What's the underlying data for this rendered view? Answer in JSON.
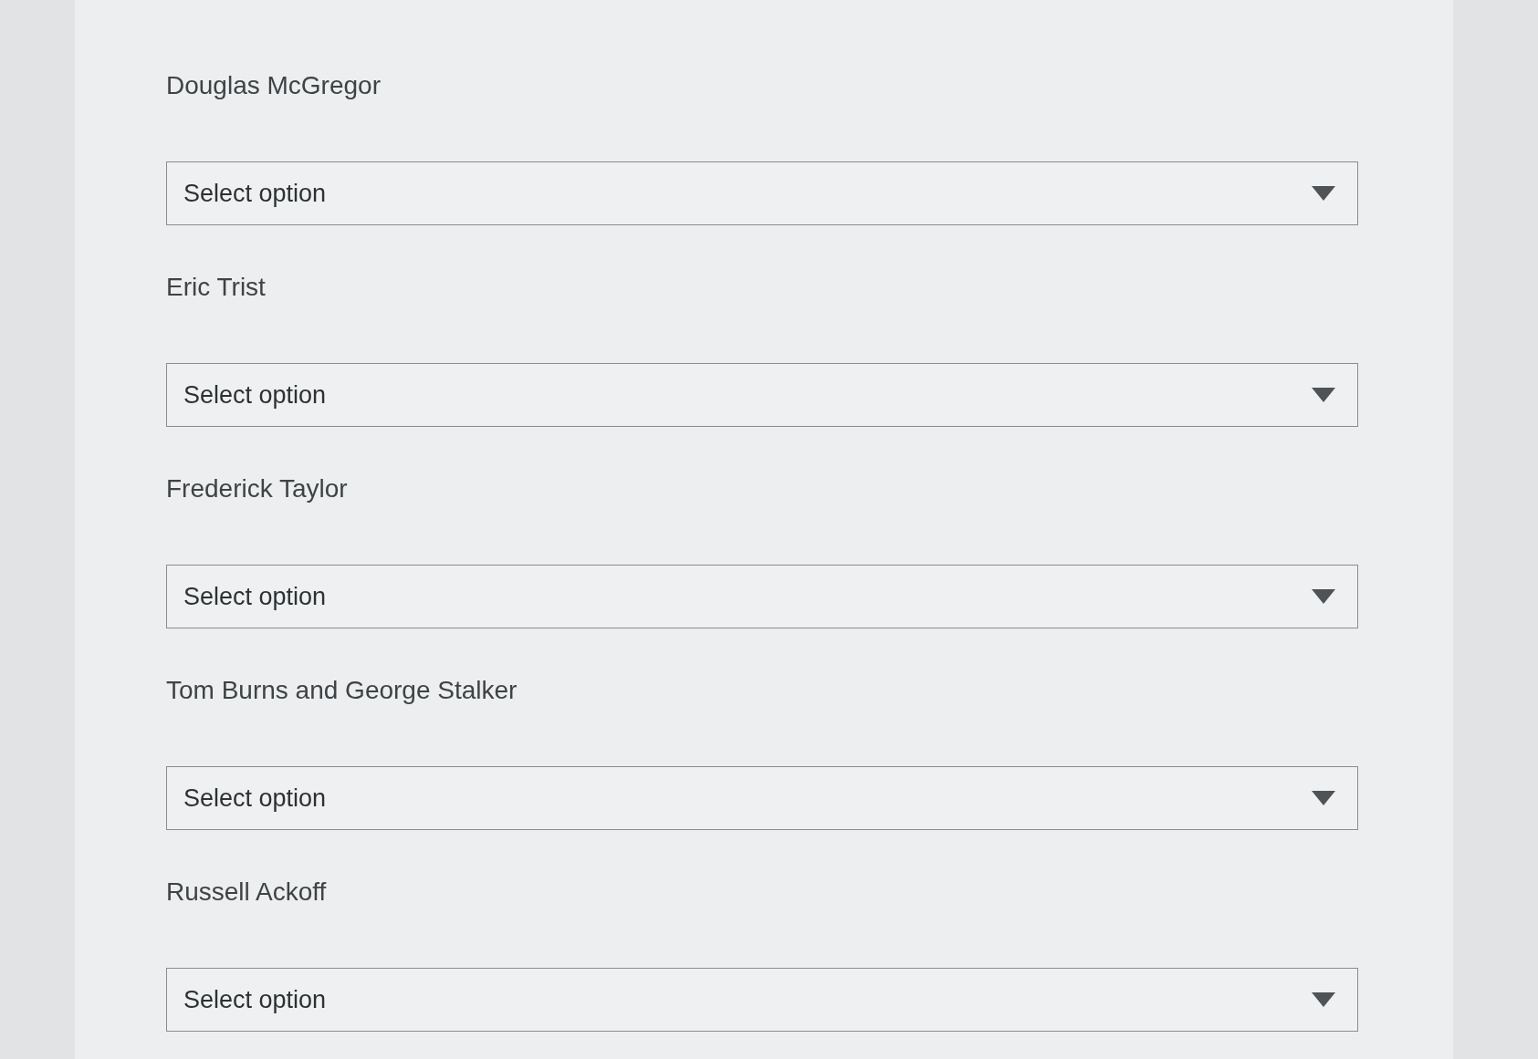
{
  "questions": [
    {
      "label": "Douglas McGregor",
      "dropdown": {
        "placeholder": "Select option"
      }
    },
    {
      "label": "Eric Trist",
      "dropdown": {
        "placeholder": "Select option"
      }
    },
    {
      "label": "Frederick Taylor",
      "dropdown": {
        "placeholder": "Select option"
      }
    },
    {
      "label": "Tom Burns and George Stalker",
      "dropdown": {
        "placeholder": "Select option"
      }
    },
    {
      "label": "Russell Ackoff",
      "dropdown": {
        "placeholder": "Select option"
      }
    }
  ]
}
